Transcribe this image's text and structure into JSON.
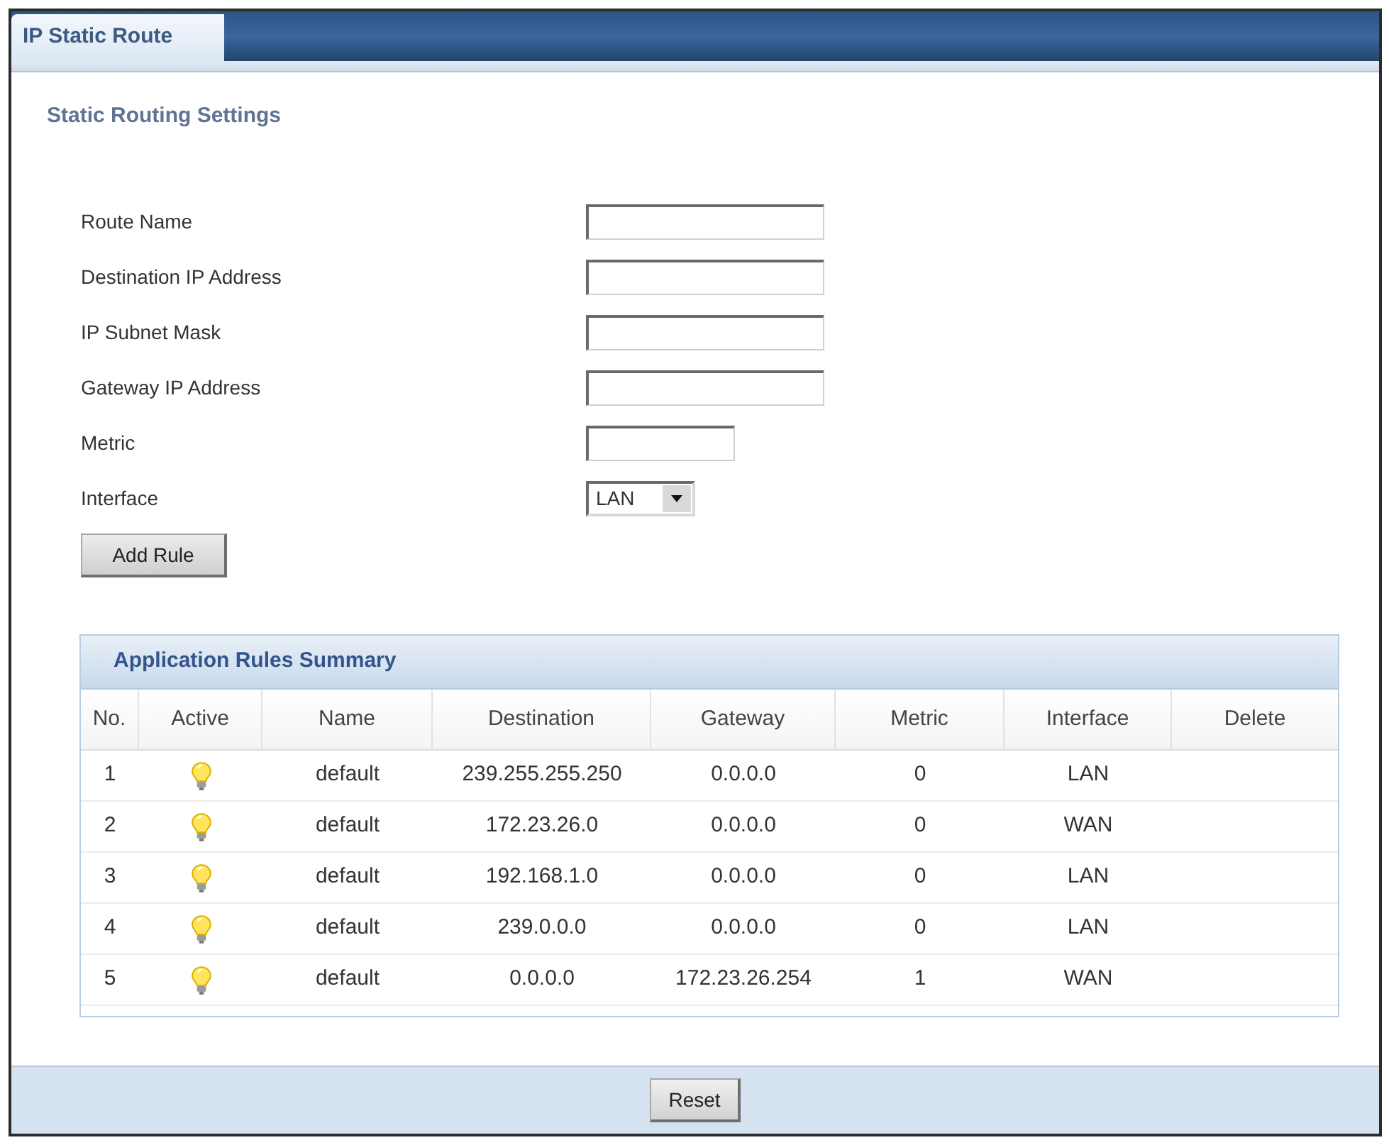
{
  "tab": {
    "label": "IP Static Route",
    "selected": true
  },
  "section_title": "Static Routing Settings",
  "fields": [
    {
      "label": "Route Name",
      "kind": "text"
    },
    {
      "label": "Destination IP Address",
      "kind": "text"
    },
    {
      "label": "IP Subnet Mask",
      "kind": "text"
    },
    {
      "label": "Gateway IP Address",
      "kind": "text"
    },
    {
      "label": "Metric",
      "kind": "number"
    },
    {
      "label": "Interface",
      "kind": "select",
      "value": "LAN"
    }
  ],
  "add_button": "Add Rule",
  "summary": {
    "title": "Application Rules Summary",
    "columns": [
      "No.",
      "Active",
      "Name",
      "Destination",
      "Gateway",
      "Metric",
      "Interface",
      "Delete"
    ],
    "rows": [
      {
        "no": "1",
        "active": true,
        "name": "default",
        "destination": "239.255.255.250",
        "gateway": "0.0.0.0",
        "metric": "0",
        "interface": "LAN"
      },
      {
        "no": "2",
        "active": true,
        "name": "default",
        "destination": "172.23.26.0",
        "gateway": "0.0.0.0",
        "metric": "0",
        "interface": "WAN"
      },
      {
        "no": "3",
        "active": true,
        "name": "default",
        "destination": "192.168.1.0",
        "gateway": "0.0.0.0",
        "metric": "0",
        "interface": "LAN"
      },
      {
        "no": "4",
        "active": true,
        "name": "default",
        "destination": "239.0.0.0",
        "gateway": "0.0.0.0",
        "metric": "0",
        "interface": "LAN"
      },
      {
        "no": "5",
        "active": true,
        "name": "default",
        "destination": "0.0.0.0",
        "gateway": "172.23.26.254",
        "metric": "1",
        "interface": "WAN"
      }
    ]
  },
  "reset_button": "Reset"
}
